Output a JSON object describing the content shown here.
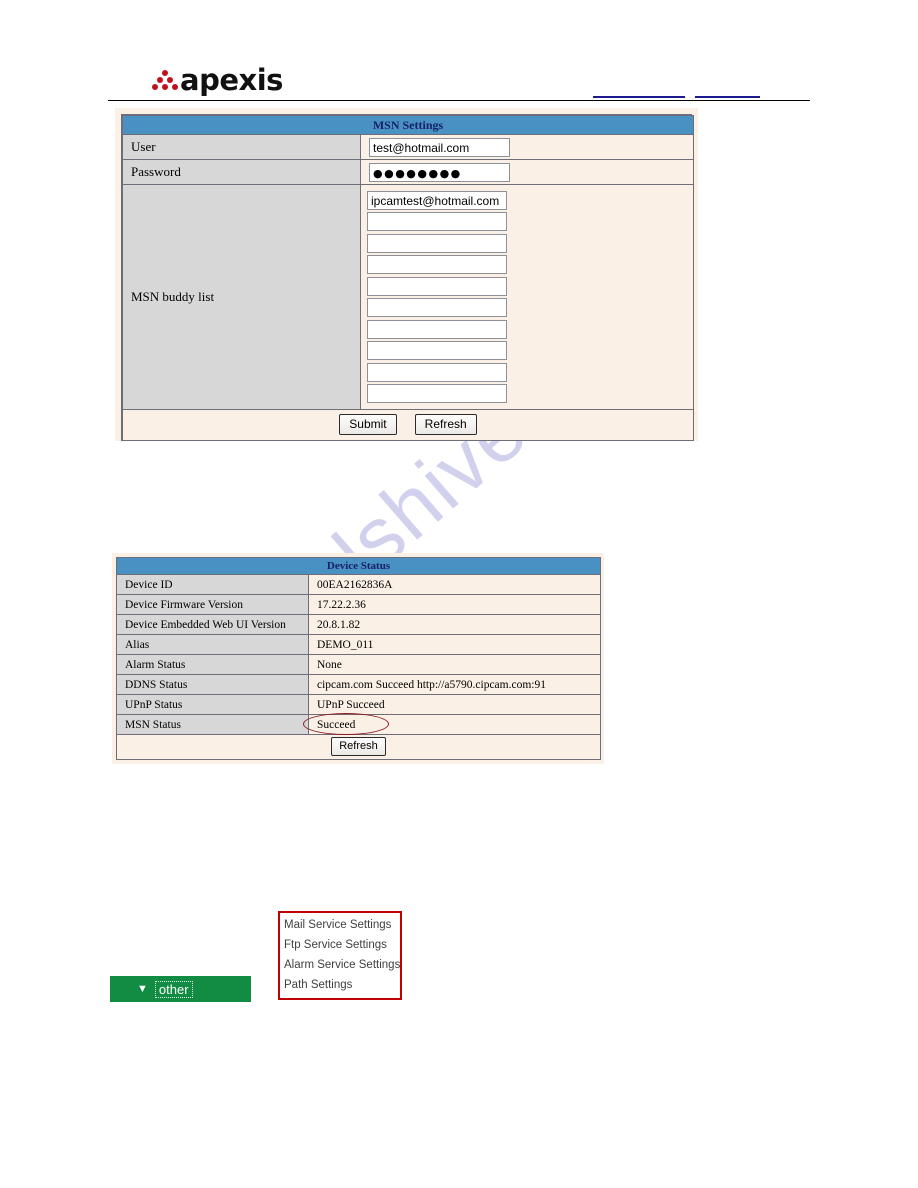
{
  "brand": {
    "name": "apexis",
    "logo_dot_color": "#c1121c"
  },
  "colors": {
    "table_header_blue": "#4a91c3",
    "panel_cream": "#fbf0e5",
    "label_gray": "#d7d7d7",
    "annotation_red": "#8c1a21",
    "menu_border_red": "#c00000",
    "other_button_green": "#118c42",
    "watermark": "#c9c9ec"
  },
  "watermark": {
    "text": "manualshive.com"
  },
  "msn_settings": {
    "title": "MSN Settings",
    "rows": [
      {
        "label": "User",
        "value": "test@hotmail.com"
      },
      {
        "label": "Password",
        "value": "●●●●●●●●"
      }
    ],
    "buddy_list_label": "MSN buddy list",
    "buddy_list": [
      "ipcamtest@hotmail.com",
      "",
      "",
      "",
      "",
      "",
      "",
      "",
      "",
      ""
    ],
    "submit_label": "Submit",
    "refresh_label": "Refresh"
  },
  "device_status": {
    "title": "Device Status",
    "rows": [
      {
        "label": "Device ID",
        "value": "00EA2162836A"
      },
      {
        "label": "Device Firmware Version",
        "value": "17.22.2.36"
      },
      {
        "label": "Device Embedded Web UI Version",
        "value": "20.8.1.82"
      },
      {
        "label": "Alias",
        "value": "DEMO_011"
      },
      {
        "label": "Alarm Status",
        "value": "None"
      },
      {
        "label": "DDNS Status",
        "value": "cipcam.com  Succeed  http://a5790.cipcam.com:91"
      },
      {
        "label": "UPnP Status",
        "value": "UPnP Succeed"
      },
      {
        "label": "MSN Status",
        "value": "Succeed"
      }
    ],
    "refresh_label": "Refresh"
  },
  "other_nav": {
    "button_label": "other",
    "caret_glyph": "▼",
    "menu_items": [
      "Mail Service Settings",
      "Ftp Service Settings",
      "Alarm Service Settings",
      "Path Settings"
    ]
  }
}
